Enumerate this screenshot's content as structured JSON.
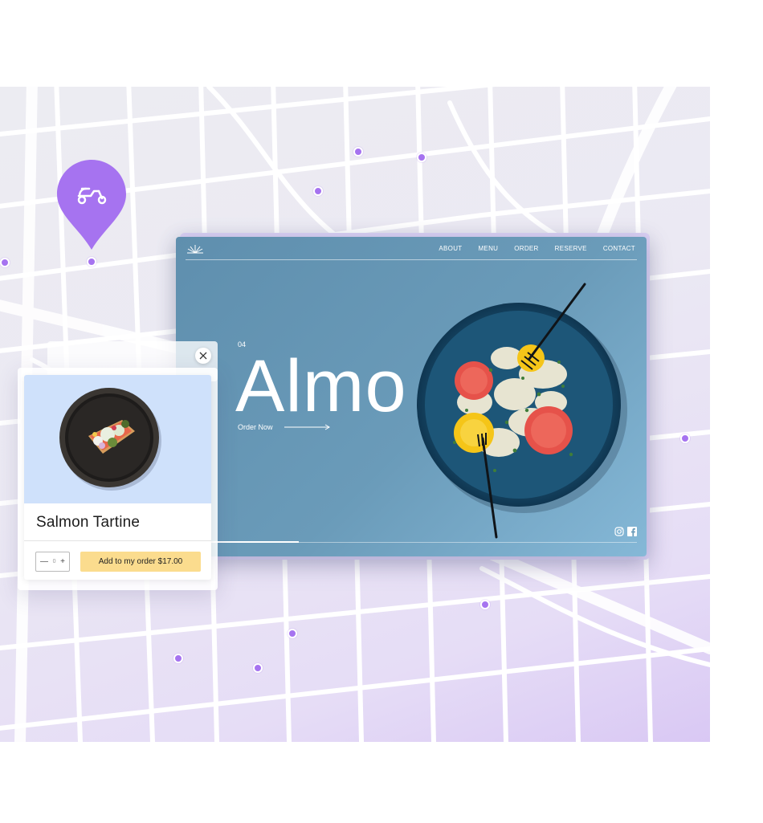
{
  "site": {
    "nav": [
      "ABOUT",
      "MENU",
      "ORDER",
      "RESERVE",
      "CONTACT"
    ],
    "slide_number": "04",
    "hero_title": "Almo",
    "cta_label": "Order Now",
    "slide_progress_fraction": 0.25,
    "social": [
      "instagram-icon",
      "facebook-icon"
    ]
  },
  "product_card": {
    "name": "Salmon Tartine",
    "quantity": "0",
    "decrement": "—",
    "increment": "+",
    "add_label": "Add to my order $17.00"
  },
  "map": {
    "pin_icon": "scooter-icon",
    "colors": {
      "accent": "#a673f0",
      "site_bg": "#6a9bb9",
      "card_photo_bg": "#cfe1fb",
      "add_button": "#fbdc8e"
    }
  }
}
